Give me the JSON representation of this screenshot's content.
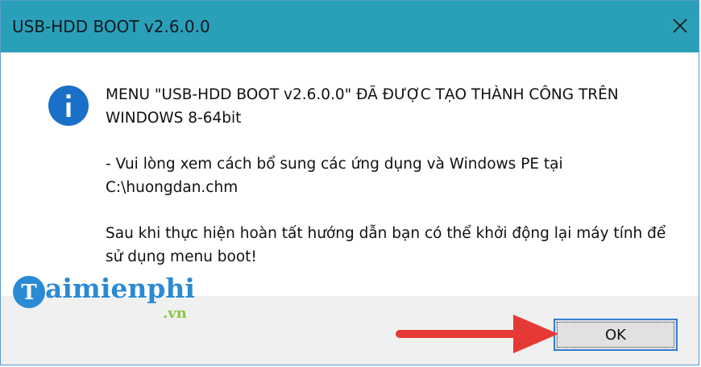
{
  "window": {
    "title": "USB-HDD BOOT v2.6.0.0",
    "close_glyph": "✕"
  },
  "message": {
    "line1": "MENU \"USB-HDD BOOT v2.6.0.0\" ĐÃ ĐƯỢC TẠO THÀNH CÔNG TRÊN WINDOWS 8-64bit",
    "line2": " - Vui lòng xem cách bổ sung các ứng dụng và Windows PE tại C:\\huongdan.chm",
    "line3": "Sau khi thực hiện hoàn tất hướng dẫn bạn có thể khởi động lại máy tính để sử dụng menu boot!"
  },
  "icons": {
    "info": "info-icon",
    "close": "close-icon",
    "arrow": "arrow-icon"
  },
  "buttons": {
    "ok_label": "OK"
  },
  "watermark": {
    "brand_initial": "T",
    "brand_rest": "aimienphi",
    "domain": ".vn"
  },
  "colors": {
    "titlebar": "#2aa0b8",
    "info_icon": "#1a6fc9",
    "ok_border": "#2f7fd1",
    "arrow": "#e53935",
    "logo_blue": "#2a8ad4",
    "logo_green": "#8cc63f"
  }
}
